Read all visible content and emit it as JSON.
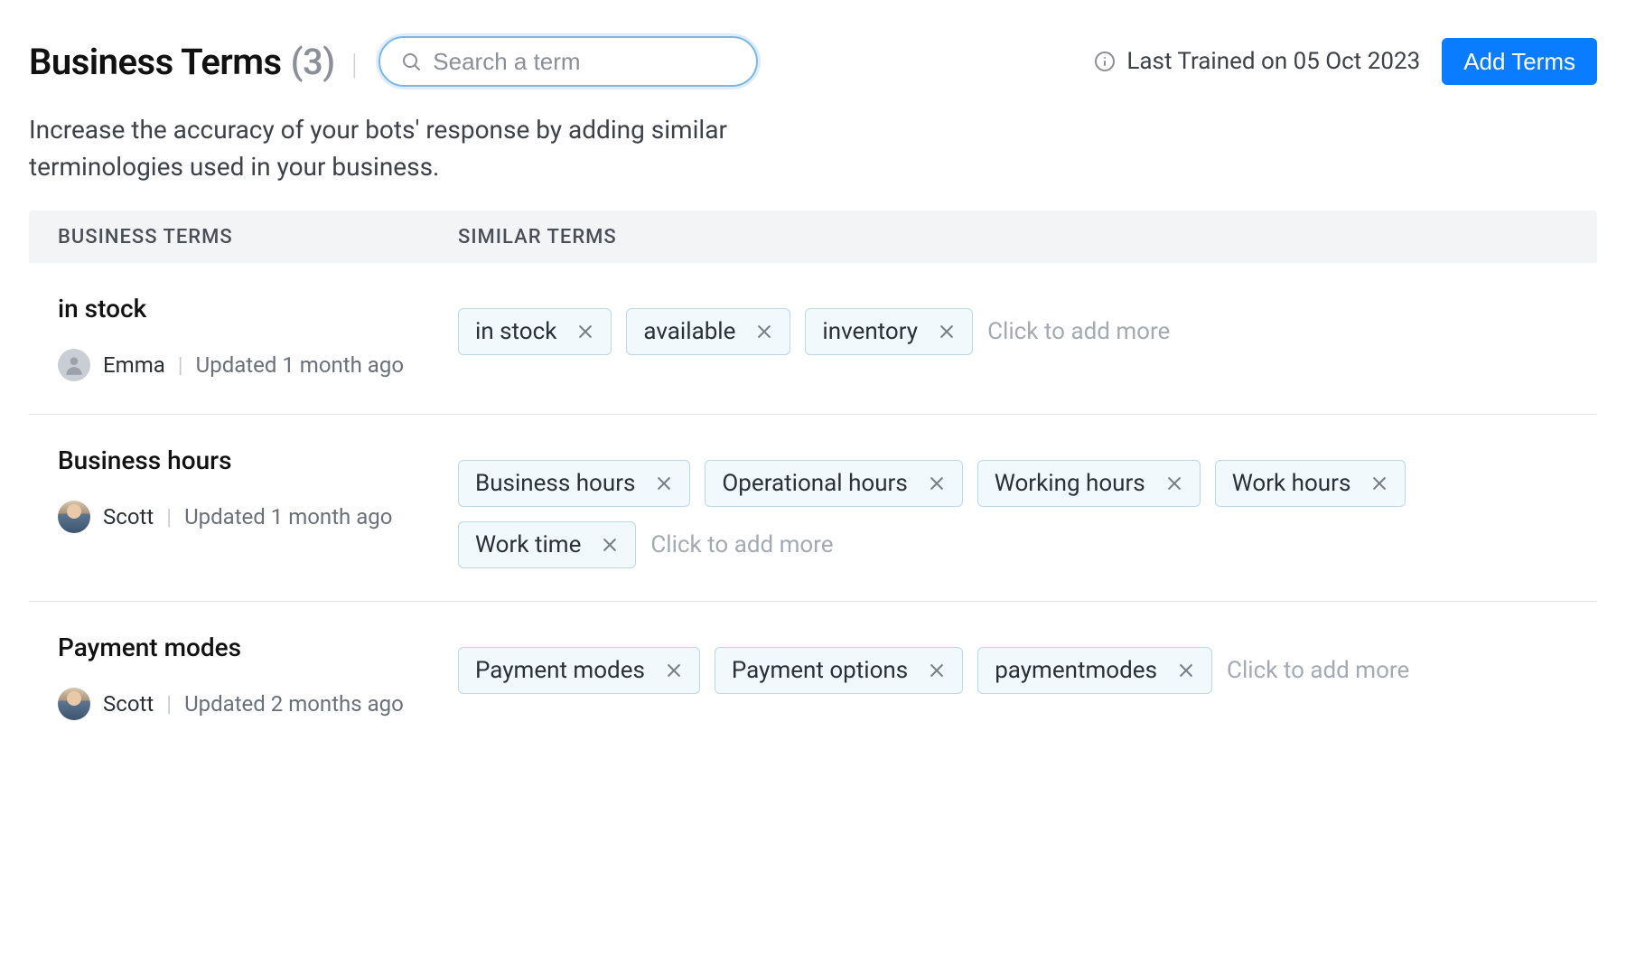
{
  "header": {
    "title": "Business Terms",
    "count": "(3)",
    "search_placeholder": "Search a term",
    "last_trained_label": "Last Trained on 05 Oct 2023",
    "add_button": "Add Terms"
  },
  "description": "Increase the accuracy of your bots' response by adding similar terminologies used in your business.",
  "columns": {
    "business": "BUSINESS TERMS",
    "similar": "SIMILAR TERMS"
  },
  "add_more_placeholder": "Click to add more",
  "rows": [
    {
      "name": "in stock",
      "author": "Emma",
      "avatar_type": "placeholder",
      "updated": "Updated 1 month ago",
      "tags": [
        "in stock",
        "available",
        "inventory"
      ]
    },
    {
      "name": "Business hours",
      "author": "Scott",
      "avatar_type": "photo",
      "updated": "Updated 1 month ago",
      "tags": [
        "Business hours",
        "Operational hours",
        "Working hours",
        "Work hours",
        "Work time"
      ]
    },
    {
      "name": "Payment modes",
      "author": "Scott",
      "avatar_type": "photo",
      "updated": "Updated 2 months ago",
      "tags": [
        "Payment modes",
        "Payment options",
        "paymentmodes"
      ]
    }
  ]
}
